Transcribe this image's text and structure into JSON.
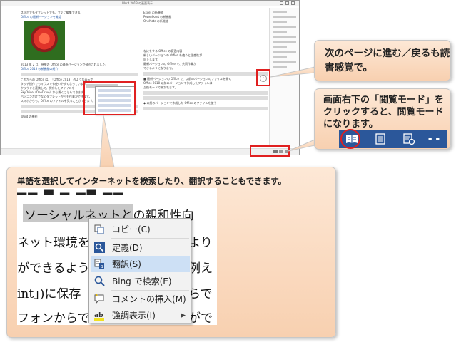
{
  "word": {
    "title": "Word 2013 の画面表示",
    "left_lines": [
      "スマホでもタブレットでも、すぐに編集できる。",
      "Office の最新バージョンを確認",
      "2013 年 2 月、待望の Office の最新バージョンが発売されました。",
      "Office 2013 の新機能の紹介",
      "これからの Office は、「Office 2013」のような表示で",
      "タッチ操作でもマウスでも使いやすくなっています。",
      "クラウドと連携して、保存したファイルを",
      "SkyDrive（OneDrive）から開くこともできます。",
      "パソコンだけでなくタブレットからも作業ができます。",
      "スマホからも、Office のファイルを見ることができます。",
      "Word の機能"
    ],
    "right_lines": [
      "Excel の新機能",
      "PowerPoint の新機能",
      "OneNote の新機能",
      "なにをする Office の変更内容",
      "新しいバージョンの Office を使うと生産性が",
      "向上します。",
      "最新バージョンの Office で、共同作業が",
      "できるようになります。",
      "■ 最新バージョンの Office で、以前のバージョンのファイルを開く",
      "Office 2010 以前のバージョンで作成したファイルは",
      "互換モードで開かれます。",
      "◆ 以前のバージョンで作成した Office のファイルを使う"
    ]
  },
  "callouts": {
    "page_turn": "次のページに進む／戻るも読書感覚で。",
    "read_mode": "画面右下の「閲覧モード」をクリックすると、閲覧モードになります。",
    "context": "単語を選択してインターネットを検索したり、翻訳することもできます。"
  },
  "zoom": {
    "line0": "ソーシャルネット",
    "selected": "ソーシャルネット",
    "line1_rest": "との親和性向",
    "line2": "ネット環境を",
    "line2_rest": "より",
    "line3": "ができるよう",
    "line3_rest": "例え",
    "line4": "int」)に保存",
    "line4_rest": "らで",
    "line5": "フォンからで",
    "line5_rest": "がで"
  },
  "context_menu": {
    "items": [
      {
        "label": "コピー(C)",
        "icon": "copy-icon"
      },
      {
        "label": "定義(D)",
        "icon": "define-icon"
      },
      {
        "label": "翻訳(S)",
        "icon": "translate-icon"
      },
      {
        "label": "Bing で検索(E)",
        "icon": "search-icon"
      },
      {
        "label": "コメントの挿入(M)",
        "icon": "comment-icon"
      },
      {
        "label": "強調表示(I)",
        "icon": "highlight-icon"
      }
    ],
    "highlighted_index": 2,
    "highlight_color": "#f0e020"
  },
  "colors": {
    "accent": "#2b579a",
    "red": "#e02020",
    "callout_top": "#fde8d6",
    "callout_bottom": "#f8d0b0"
  }
}
